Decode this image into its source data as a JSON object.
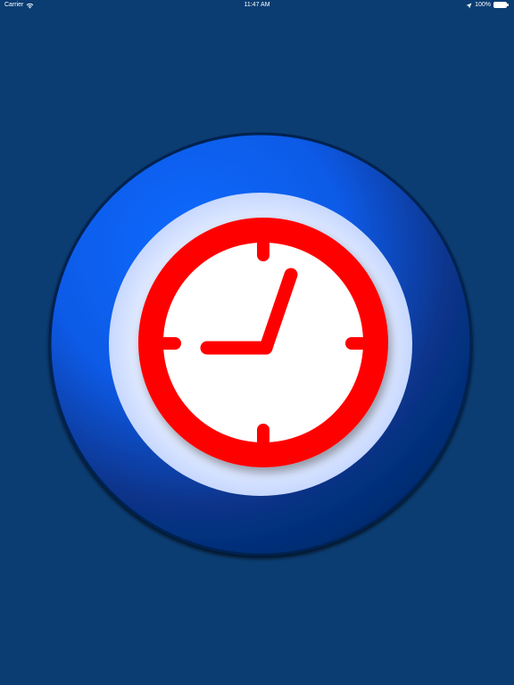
{
  "status_bar": {
    "carrier": "Carrier",
    "time": "11:47 AM",
    "battery_percent": "100%",
    "wifi_icon": "wifi-icon",
    "location_icon": "location-arrow-icon",
    "battery_icon": "battery-full-icon"
  },
  "launch_screen": {
    "icon": "clock-icon",
    "colors": {
      "background": "#0b3d73",
      "outer_ring": "#0a66ff",
      "inner_disc": "#dfe9ff",
      "clock_ring": "#ff0000",
      "clock_face": "#ffffff"
    }
  }
}
